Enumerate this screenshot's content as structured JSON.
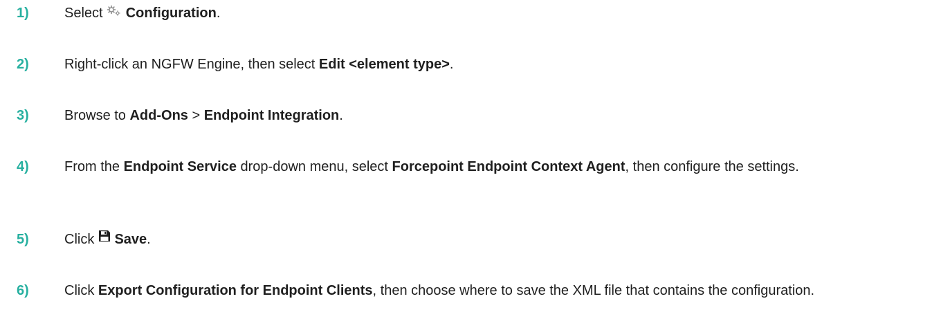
{
  "steps": [
    {
      "number": "1)",
      "parts": {
        "t1": "Select ",
        "icon": "gear-icon",
        "b1": "Configuration",
        "t2": "."
      }
    },
    {
      "number": "2)",
      "parts": {
        "t1": "Right-click an NGFW Engine, then select ",
        "b1": "Edit <element type>",
        "t2": "."
      }
    },
    {
      "number": "3)",
      "parts": {
        "t1": "Browse to ",
        "b1": "Add-Ons",
        "t2": " > ",
        "b2": "Endpoint Integration",
        "t3": "."
      }
    },
    {
      "number": "4)",
      "parts": {
        "t1": "From the ",
        "b1": "Endpoint Service",
        "t2": " drop-down menu, select ",
        "b2": "Forcepoint Endpoint Context Agent",
        "t3": ", then configure the settings."
      }
    },
    {
      "number": "5)",
      "parts": {
        "t1": "Click ",
        "icon": "save-icon",
        "b1": "Save",
        "t2": "."
      }
    },
    {
      "number": "6)",
      "parts": {
        "t1": "Click ",
        "b1": "Export Configuration for Endpoint Clients",
        "t2": ", then choose where to save the XML file that contains the configuration."
      }
    }
  ],
  "colors": {
    "step_number": "#27b0a0",
    "text": "#1f1f1f",
    "icon_gear": "#8a8a8a",
    "icon_save": "#1f1f1f"
  }
}
